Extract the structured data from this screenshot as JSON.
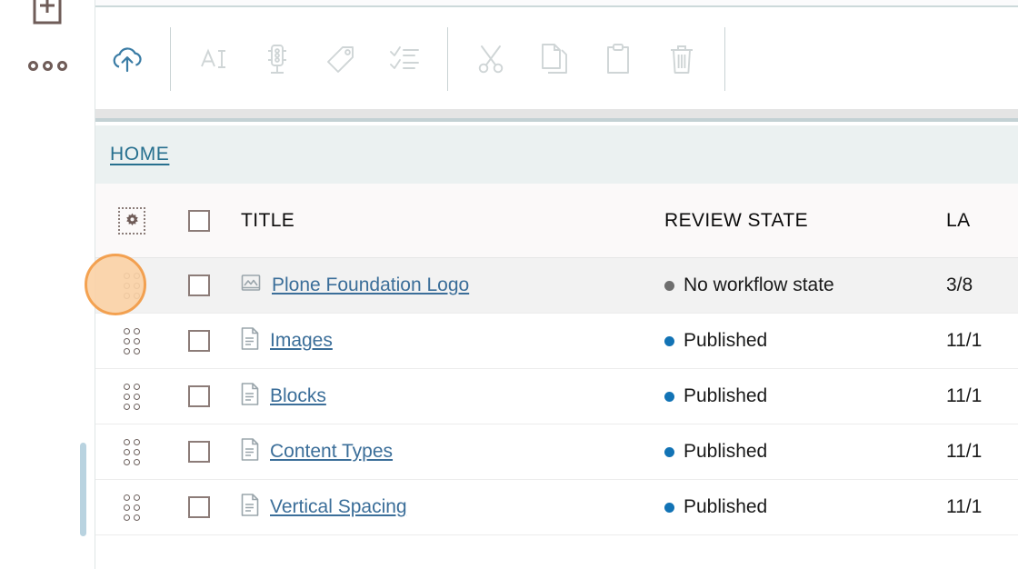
{
  "sidebar": {
    "add_button": {
      "icon": "document-plus-icon",
      "label": ""
    },
    "more_button": {
      "icon": "more-horizontal-icon",
      "label": ""
    }
  },
  "toolbar": {
    "items": [
      {
        "id": "upload",
        "icon": "upload-cloud-icon",
        "label": "Upload",
        "state": "active"
      },
      {
        "id": "rename",
        "icon": "rename-icon",
        "label": "Rename",
        "state": "disabled"
      },
      {
        "id": "workflow",
        "icon": "traffic-light-icon",
        "label": "State",
        "state": "disabled"
      },
      {
        "id": "tags",
        "icon": "tag-icon",
        "label": "Tags",
        "state": "disabled"
      },
      {
        "id": "properties",
        "icon": "checklist-icon",
        "label": "Properties",
        "state": "disabled"
      },
      {
        "id": "cut",
        "icon": "scissors-icon",
        "label": "Cut",
        "state": "disabled"
      },
      {
        "id": "copy",
        "icon": "copy-icon",
        "label": "Copy",
        "state": "disabled"
      },
      {
        "id": "paste",
        "icon": "paste-icon",
        "label": "Paste",
        "state": "disabled"
      },
      {
        "id": "delete",
        "icon": "trash-icon",
        "label": "Delete",
        "state": "disabled"
      }
    ]
  },
  "breadcrumb": {
    "items": [
      {
        "label": "HOME",
        "href": "#"
      }
    ],
    "home_label": "HOME"
  },
  "table": {
    "columns": {
      "settings_icon": "gear-icon",
      "select_all": "select-all-checkbox",
      "title": "TITLE",
      "review_state": "REVIEW STATE",
      "last_modified": "LA"
    },
    "rows": [
      {
        "title": "Plone Foundation Logo",
        "icon": "image-file-icon",
        "review_state": "No workflow state",
        "state_color": "#6e6e6e",
        "last_modified": "3/8",
        "selected": false,
        "highlighted": true
      },
      {
        "title": "Images",
        "icon": "document-file-icon",
        "review_state": "Published",
        "state_color": "#1273b5",
        "last_modified": "11/1",
        "selected": false,
        "highlighted": false
      },
      {
        "title": "Blocks",
        "icon": "document-file-icon",
        "review_state": "Published",
        "state_color": "#1273b5",
        "last_modified": "11/1",
        "selected": false,
        "highlighted": false
      },
      {
        "title": "Content Types",
        "icon": "document-file-icon",
        "review_state": "Published",
        "state_color": "#1273b5",
        "last_modified": "11/1",
        "selected": false,
        "highlighted": false
      },
      {
        "title": "Vertical Spacing",
        "icon": "document-file-icon",
        "review_state": "Published",
        "state_color": "#1273b5",
        "last_modified": "11/1",
        "selected": false,
        "highlighted": false
      }
    ]
  },
  "colors": {
    "link": "#3b6e99",
    "breadcrumb_link": "#27708f",
    "toolbar_active": "#3a7ca5",
    "toolbar_disabled": "#cfd5d6",
    "highlight_fill": "#fbd2a6",
    "highlight_ring": "#f3983f",
    "row_alt_bg": "#f2f2f2",
    "breadcrumb_bg": "#ebf1f1",
    "scrollbar": "#b9d3e0"
  }
}
